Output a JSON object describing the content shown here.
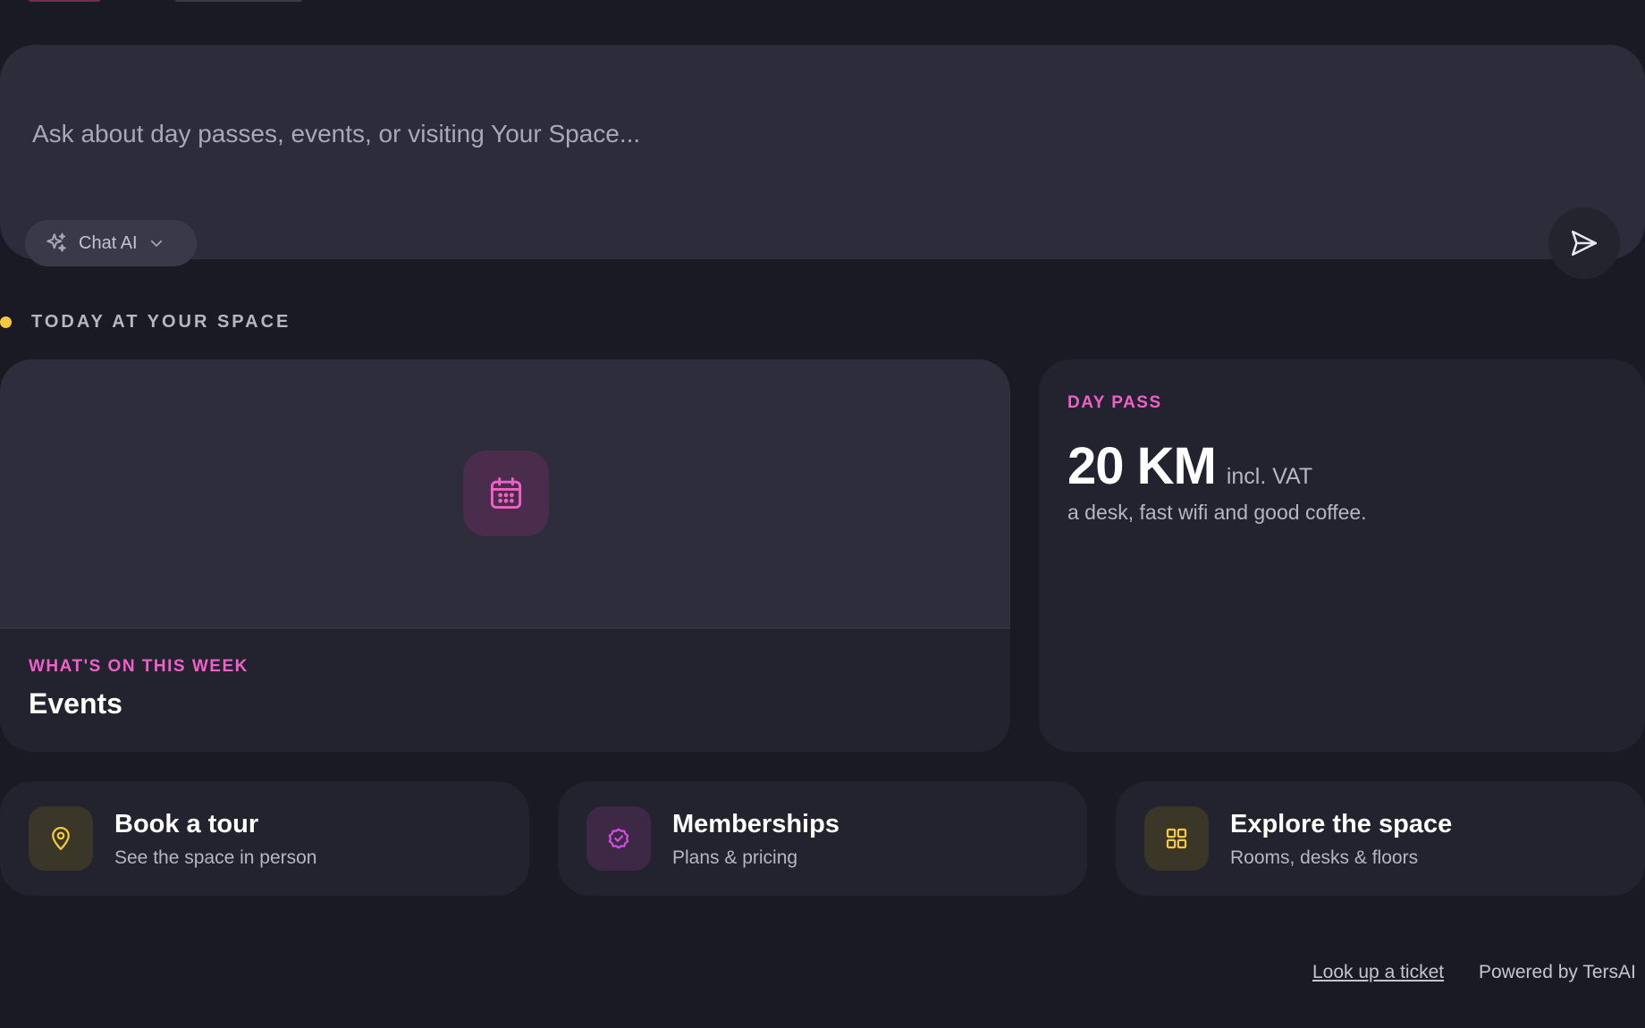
{
  "chat": {
    "placeholder": "Ask about day passes, events, or visiting Your Space...",
    "model_label": "Chat AI",
    "icons": {
      "model": "sparkle-icon",
      "model_dropdown": "chevron-down-icon",
      "send": "send-icon"
    }
  },
  "section": {
    "title": "TODAY AT YOUR SPACE",
    "dot_color": "#f5c842"
  },
  "events_card": {
    "kicker": "WHAT'S ON THIS WEEK",
    "title": "Events",
    "icon": "calendar-icon"
  },
  "day_pass": {
    "kicker": "DAY PASS",
    "price": "20 KM",
    "vat_note": "incl. VAT",
    "description": "a desk, fast wifi and good coffee."
  },
  "actions": [
    {
      "title": "Book a tour",
      "subtitle": "See the space in person",
      "icon": "map-pin-icon",
      "accent": "#f5c842"
    },
    {
      "title": "Memberships",
      "subtitle": "Plans & pricing",
      "icon": "badge-check-icon",
      "accent": "#d14fe0"
    },
    {
      "title": "Explore the space",
      "subtitle": "Rooms, desks & floors",
      "icon": "grid-icon",
      "accent": "#f5c842"
    }
  ],
  "footer": {
    "ticket_link": "Look up a ticket",
    "powered_by": "Powered by TersAI"
  },
  "colors": {
    "background": "#1a1a24",
    "card": "#23232f",
    "accent_pink": "#f060c8",
    "accent_yellow": "#f5c842"
  }
}
